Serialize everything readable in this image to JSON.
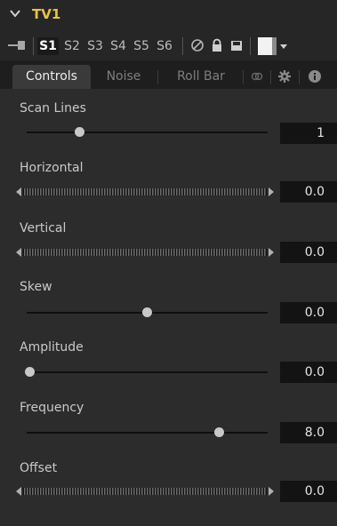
{
  "node": {
    "title": "TV1"
  },
  "versions": [
    "S1",
    "S2",
    "S3",
    "S4",
    "S5",
    "S6"
  ],
  "active_version": "S1",
  "icons": {
    "collapse": "chevron-down-icon",
    "pin": "pin-icon",
    "reset": "disable-icon",
    "lock": "lock-icon",
    "save": "save-icon",
    "color": "color-swatch-icon",
    "dropdown": "chevron-down-icon"
  },
  "tabs": [
    {
      "label": "Controls",
      "active": true
    },
    {
      "label": "Noise",
      "active": false
    },
    {
      "label": "Roll Bar",
      "active": false
    }
  ],
  "tab_icons": [
    "link-icon",
    "gear-icon",
    "info-icon"
  ],
  "controls": [
    {
      "label": "Scan Lines",
      "type": "slider",
      "value": "1",
      "position": 0.22
    },
    {
      "label": "Horizontal",
      "type": "thumbwheel",
      "value": "0.0"
    },
    {
      "label": "Vertical",
      "type": "thumbwheel",
      "value": "0.0"
    },
    {
      "label": "Skew",
      "type": "slider",
      "value": "0.0",
      "position": 0.5
    },
    {
      "label": "Amplitude",
      "type": "slider",
      "value": "0.0",
      "position": 0.0
    },
    {
      "label": "Frequency",
      "type": "slider",
      "value": "8.0",
      "position": 0.8
    },
    {
      "label": "Offset",
      "type": "thumbwheel",
      "value": "0.0"
    }
  ]
}
